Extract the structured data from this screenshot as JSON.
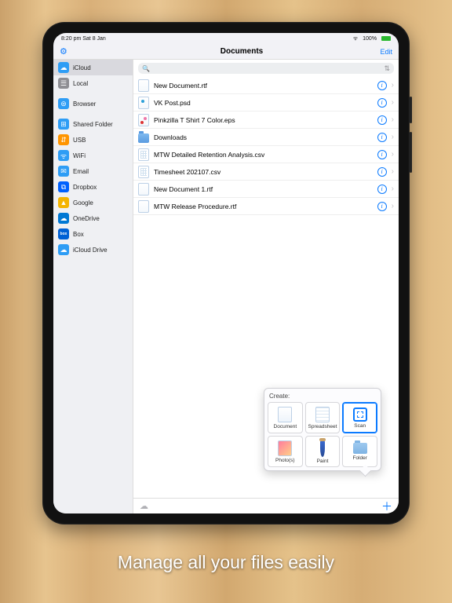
{
  "caption": "Manage all your files easily",
  "status": {
    "time": "8:20 pm  Sat 8 Jan",
    "wifi": "▾",
    "battery_text": "100%"
  },
  "nav": {
    "title": "Documents",
    "edit": "Edit"
  },
  "search": {
    "placeholder": ""
  },
  "sidebar": {
    "items": [
      {
        "label": "iCloud",
        "color": "#2e9df5",
        "glyph": "☁",
        "selected": true
      },
      {
        "label": "Local",
        "color": "#8e8e93",
        "glyph": "☰"
      },
      {
        "label": "Browser",
        "color": "#2e9df5",
        "glyph": "⊜"
      },
      {
        "label": "Shared Folder",
        "color": "#2e9df5",
        "glyph": "⊞"
      },
      {
        "label": "USB",
        "color": "#ff9500",
        "glyph": "⇵"
      },
      {
        "label": "WiFi",
        "color": "#2e9df5",
        "glyph": "ᯤ"
      },
      {
        "label": "Email",
        "color": "#2e9df5",
        "glyph": "✉"
      },
      {
        "label": "Dropbox",
        "color": "#0061fe",
        "glyph": "⧉"
      },
      {
        "label": "Google",
        "color": "#f4b400",
        "glyph": "▲"
      },
      {
        "label": "OneDrive",
        "color": "#0078d4",
        "glyph": "☁"
      },
      {
        "label": "Box",
        "color": "#0061d5",
        "glyph": "box",
        "smalltext": true
      },
      {
        "label": "iCloud Drive",
        "color": "#2e9df5",
        "glyph": "☁"
      }
    ]
  },
  "files": [
    {
      "name": "New Document.rtf",
      "type": "doc"
    },
    {
      "name": "VK Post.psd",
      "type": "psd"
    },
    {
      "name": "Pinkzilla T Shirt 7 Color.eps",
      "type": "eps"
    },
    {
      "name": "Downloads",
      "type": "folder"
    },
    {
      "name": "MTW Detailed Retention Analysis.csv",
      "type": "csv"
    },
    {
      "name": "Timesheet 202107.csv",
      "type": "csv"
    },
    {
      "name": "New Document 1.rtf",
      "type": "doc"
    },
    {
      "name": "MTW Release Procedure.rtf",
      "type": "doc"
    }
  ],
  "create": {
    "header": "Create:",
    "items": [
      {
        "label": "Document",
        "kind": "doc"
      },
      {
        "label": "Spreadsheet",
        "kind": "sheet"
      },
      {
        "label": "Scan",
        "kind": "scan",
        "selected": true
      },
      {
        "label": "Photo(s)",
        "kind": "photo"
      },
      {
        "label": "Paint",
        "kind": "paint"
      },
      {
        "label": "Folder",
        "kind": "folder"
      }
    ]
  }
}
